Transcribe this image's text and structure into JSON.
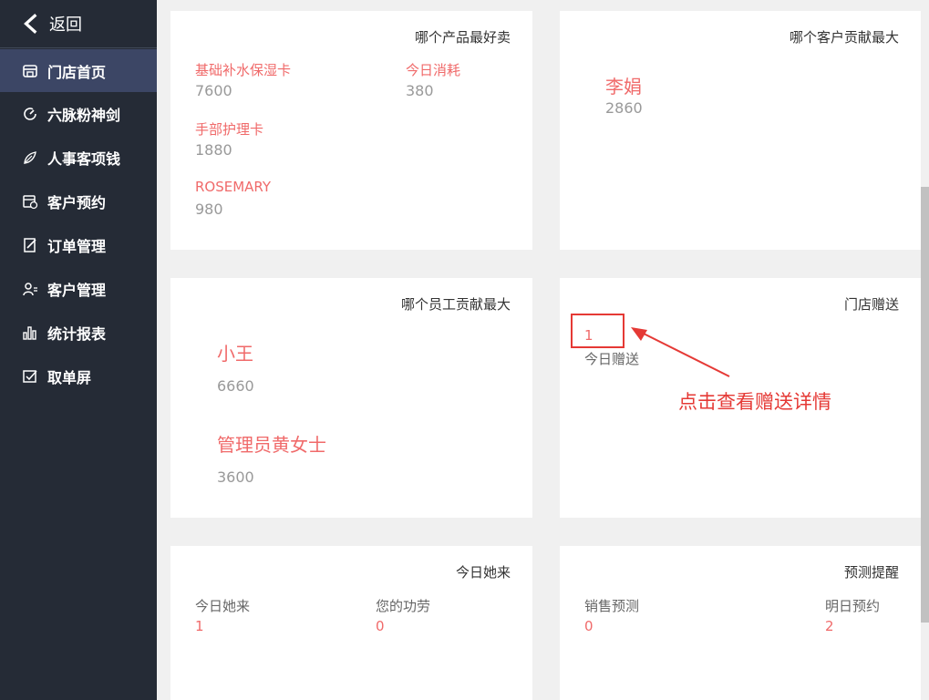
{
  "sidebar": {
    "back_label": "返回",
    "items": [
      {
        "label": "门店首页",
        "icon": "store-icon"
      },
      {
        "label": "六脉粉神剑",
        "icon": "gauge-icon"
      },
      {
        "label": "人事客项钱",
        "icon": "leaf-icon"
      },
      {
        "label": "客户预约",
        "icon": "calendar-clock-icon"
      },
      {
        "label": "订单管理",
        "icon": "edit-doc-icon"
      },
      {
        "label": "客户管理",
        "icon": "users-icon"
      },
      {
        "label": "统计报表",
        "icon": "bar-chart-icon"
      },
      {
        "label": "取单屏",
        "icon": "checklist-icon"
      }
    ]
  },
  "cards": {
    "best_product": {
      "title": "哪个产品最好卖",
      "items": [
        {
          "name": "基础补水保湿卡",
          "value": "7600"
        },
        {
          "name": "今日消耗",
          "value": "380"
        },
        {
          "name": "手部护理卡",
          "value": "1880"
        },
        {
          "name": "ROSEMARY",
          "value": "980"
        }
      ]
    },
    "best_customer": {
      "title": "哪个客户贡献最大",
      "name": "李娟",
      "value": "2860"
    },
    "best_staff": {
      "title": "哪个员工贡献最大",
      "items": [
        {
          "name": "小王",
          "value": "6660"
        },
        {
          "name": "管理员黄女士",
          "value": "3600"
        }
      ]
    },
    "store_gift": {
      "title": "门店赠送",
      "value": "1",
      "label": "今日赠送",
      "annotation": "点击查看赠送详情"
    },
    "today_visit": {
      "title": "今日她来",
      "stats": [
        {
          "label": "今日她来",
          "value": "1"
        },
        {
          "label": "您的功劳",
          "value": "0"
        }
      ]
    },
    "forecast": {
      "title": "预测提醒",
      "stats": [
        {
          "label": "销售预测",
          "value": "0"
        },
        {
          "label": "明日预约",
          "value": "2"
        }
      ]
    }
  },
  "colors": {
    "sidebar_bg": "#252b36",
    "sidebar_active": "#3c4665",
    "accent_red": "#f06a6a",
    "annotation_red": "#e53935"
  }
}
